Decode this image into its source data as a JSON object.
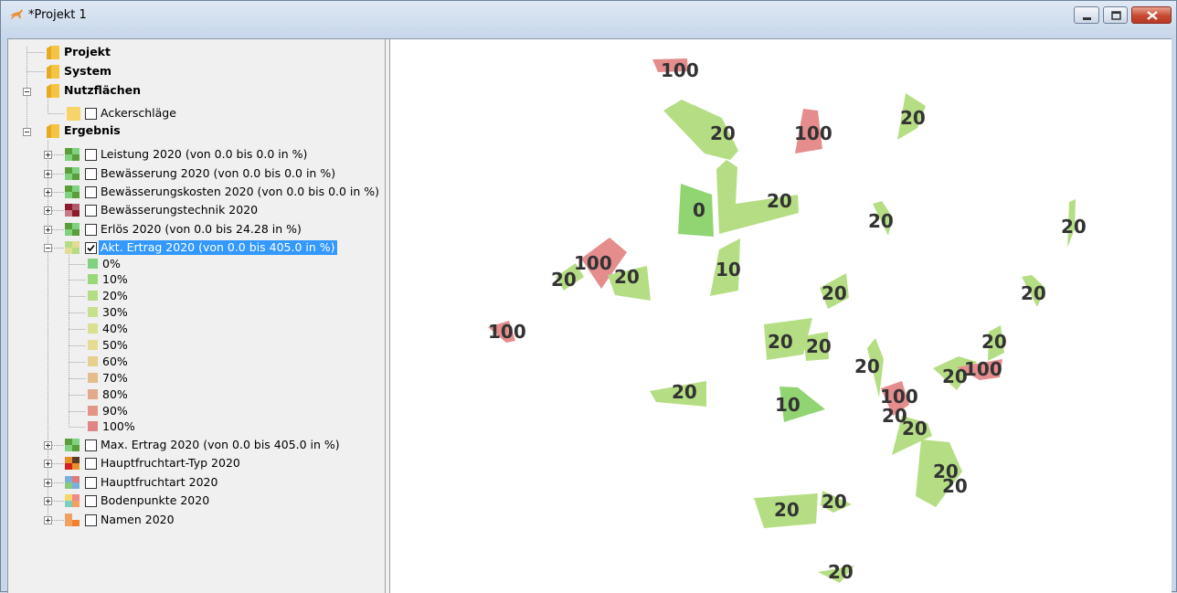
{
  "window": {
    "title": "*Projekt 1"
  },
  "tree": {
    "projekt": "Projekt",
    "system": "System",
    "nutzflaechen": "Nutzflächen",
    "ackerschlaege": "Ackerschläge",
    "ergebnis": "Ergebnis",
    "layers": [
      {
        "label": "Leistung 2020 (von 0.0 bis 0.0 in %)",
        "checked": false
      },
      {
        "label": "Bewässerung 2020 (von 0.0 bis 0.0 in %)",
        "checked": false
      },
      {
        "label": "Bewässerungskosten 2020 (von 0.0 bis 0.0 in %)",
        "checked": false
      },
      {
        "label": "Bewässerungstechnik 2020",
        "checked": false
      },
      {
        "label": "Erlös 2020 (von 0.0 bis 24.28 in %)",
        "checked": false
      },
      {
        "label": "Akt. Ertrag 2020 (von 0.0 bis 405.0 in %)",
        "checked": true,
        "selected": true
      },
      {
        "label": "Max. Ertrag 2020 (von 0.0 bis 405.0 in %)",
        "checked": false
      },
      {
        "label": "Hauptfruchtart-Typ 2020",
        "checked": false
      },
      {
        "label": "Hauptfruchtart 2020",
        "checked": false
      },
      {
        "label": "Bodenpunkte 2020",
        "checked": false
      },
      {
        "label": "Namen 2020",
        "checked": false
      }
    ],
    "legend": [
      {
        "label": "0%",
        "color": "#7fd27f"
      },
      {
        "label": "10%",
        "color": "#98d77a"
      },
      {
        "label": "20%",
        "color": "#b5de84"
      },
      {
        "label": "30%",
        "color": "#c7e08c"
      },
      {
        "label": "40%",
        "color": "#d9e08f"
      },
      {
        "label": "50%",
        "color": "#e3dc92"
      },
      {
        "label": "60%",
        "color": "#e6cf8f"
      },
      {
        "label": "70%",
        "color": "#e3bd8c"
      },
      {
        "label": "80%",
        "color": "#e2a98a"
      },
      {
        "label": "90%",
        "color": "#e29687"
      },
      {
        "label": "100%",
        "color": "#e08585"
      }
    ]
  },
  "map": {
    "colors": {
      "green": "#b5de84",
      "green_dark": "#91d472",
      "red": "#e58d8d"
    },
    "labels": [
      "100",
      "20",
      "100",
      "20",
      "0",
      "20",
      "20",
      "20",
      "100",
      "20",
      "20",
      "10",
      "20",
      "20",
      "100",
      "20",
      "20",
      "20",
      "20",
      "20",
      "20",
      "100",
      "20",
      "10",
      "100",
      "20",
      "20",
      "20",
      "20",
      "20",
      "20",
      "20"
    ]
  }
}
